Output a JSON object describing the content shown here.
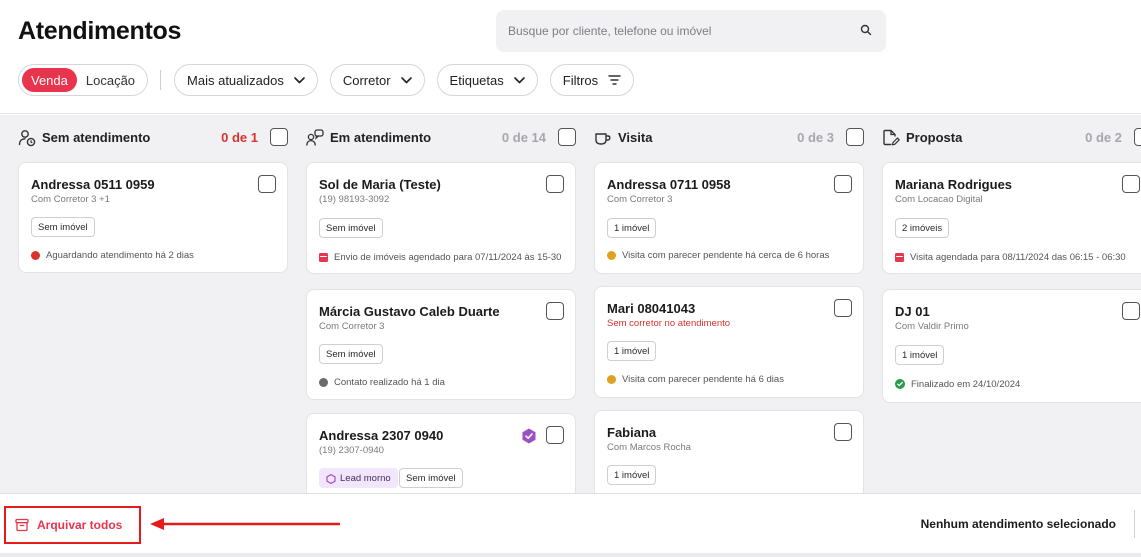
{
  "header": {
    "title": "Atendimentos",
    "search_placeholder": "Busque por cliente, telefone ou imóvel"
  },
  "filters": {
    "segment": [
      {
        "label": "Venda",
        "active": true
      },
      {
        "label": "Locação",
        "active": false
      }
    ],
    "sort_label": "Mais atualizados",
    "broker_label": "Corretor",
    "tags_label": "Etiquetas",
    "filters_label": "Filtros"
  },
  "columns": [
    {
      "title": "Sem atendimento",
      "count": "0 de 1",
      "icon": "user-clock-icon",
      "cards": [
        {
          "name": "Andressa 0511 0959",
          "sub": "Com Corretor 3 +1",
          "tags": [
            "Sem imóvel"
          ],
          "status": "Aguardando atendimento há 2 dias",
          "status_color": "#d6342d"
        }
      ]
    },
    {
      "title": "Em atendimento",
      "count": "0 de 14",
      "icon": "users-chat-icon",
      "cards": [
        {
          "name": "Sol de Maria (Teste)",
          "sub": "(19) 98193-3092",
          "tags": [
            "Sem imóvel"
          ],
          "status": "Envio de imóveis agendado para 07/11/2024 às 15-30",
          "status_color": "#e8344d"
        },
        {
          "name": "Márcia Gustavo Caleb Duarte",
          "sub": "Com Corretor 3",
          "tags": [
            "Sem imóvel"
          ],
          "status": "Contato realizado há 1 dia",
          "status_color": "#6b6b6b"
        },
        {
          "name": "Andressa 2307 0940",
          "sub": "(19) 2307-0940",
          "tags": [
            "Lead morno",
            "Sem imóvel"
          ],
          "status": "",
          "status_color": ""
        }
      ]
    },
    {
      "title": "Visita",
      "count": "0 de 3",
      "icon": "coffee-cup-icon",
      "cards": [
        {
          "name": "Andressa 0711 0958",
          "sub": "Com Corretor 3",
          "tags": [
            "1 imóvel"
          ],
          "status": "Visita com parecer pendente há cerca de 6 horas",
          "status_color": "#e0a020"
        },
        {
          "name": "Mari 08041043",
          "sub": "Sem corretor no atendimento",
          "tags": [
            "1 imóvel"
          ],
          "status": "Visita com parecer pendente há 6 dias",
          "status_color": "#e0a020"
        },
        {
          "name": "Fabiana",
          "sub": "Com Marcos Rocha",
          "tags": [
            "1 imóvel"
          ],
          "status": "",
          "status_color": ""
        }
      ]
    },
    {
      "title": "Proposta",
      "count": "0 de 2",
      "icon": "document-pen-icon",
      "cards": [
        {
          "name": "Mariana Rodrigues",
          "sub": "Com Locacao Digital",
          "tags": [
            "2 imóveis"
          ],
          "status": "Visita agendada para 08/11/2024 das 06:15 - 06:30",
          "status_color": "#e8344d"
        },
        {
          "name": "DJ 01",
          "sub": "Com Valdir Primo",
          "tags": [
            "1 imóvel"
          ],
          "status": "Finalizado em 24/10/2024",
          "status_color": "#2a9d4a"
        }
      ]
    }
  ],
  "footer": {
    "archive_label": "Arquivar todos",
    "none_selected": "Nenhum atendimento selecionado"
  },
  "colors": {
    "accent": "#e8344d",
    "annotation_red": "#e31b1b"
  }
}
